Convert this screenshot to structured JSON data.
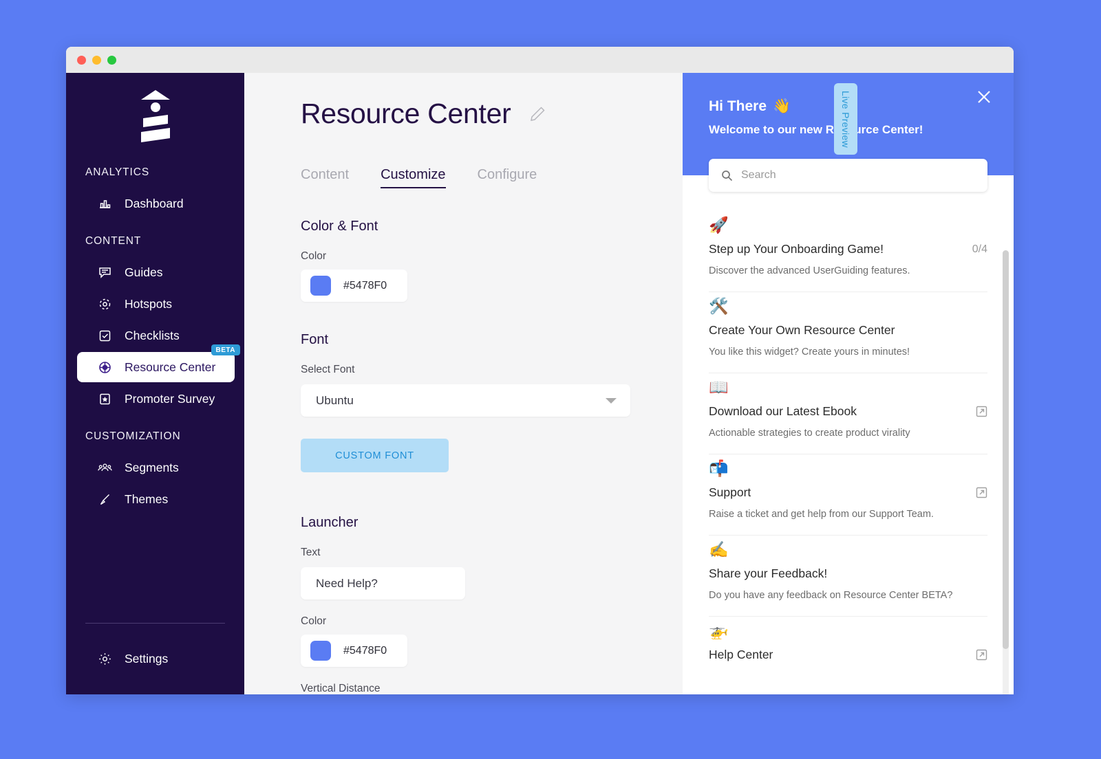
{
  "window": {
    "traffic_lights": [
      "close",
      "minimize",
      "maximize"
    ]
  },
  "sidebar": {
    "logo_name": "lighthouse-logo",
    "sections": [
      {
        "label": "ANALYTICS",
        "items": [
          {
            "label": "Dashboard",
            "icon": "bar-chart-icon",
            "active": false
          }
        ]
      },
      {
        "label": "CONTENT",
        "items": [
          {
            "label": "Guides",
            "icon": "speech-bubble-icon",
            "active": false
          },
          {
            "label": "Hotspots",
            "icon": "hotspot-icon",
            "active": false
          },
          {
            "label": "Checklists",
            "icon": "checkbox-icon",
            "active": false
          },
          {
            "label": "Resource Center",
            "icon": "lifebuoy-icon",
            "active": true,
            "badge": "BETA"
          },
          {
            "label": "Promoter Survey",
            "icon": "survey-icon",
            "active": false
          }
        ]
      },
      {
        "label": "CUSTOMIZATION",
        "items": [
          {
            "label": "Segments",
            "icon": "users-icon",
            "active": false
          },
          {
            "label": "Themes",
            "icon": "paintbrush-icon",
            "active": false
          }
        ]
      }
    ],
    "footer": {
      "label": "Settings",
      "icon": "gear-icon"
    }
  },
  "main": {
    "page_title": "Resource Center",
    "edit_icon": "pencil-icon",
    "tabs": [
      {
        "label": "Content",
        "active": false
      },
      {
        "label": "Customize",
        "active": true
      },
      {
        "label": "Configure",
        "active": false
      }
    ],
    "color_font": {
      "heading": "Color & Font",
      "color_label": "Color",
      "color_value": "#5478F0",
      "font_heading": "Font",
      "select_font_label": "Select Font",
      "selected_font": "Ubuntu",
      "custom_font_button": "CUSTOM FONT"
    },
    "launcher": {
      "heading": "Launcher",
      "text_label": "Text",
      "text_value": "Need Help?",
      "color_label": "Color",
      "color_value": "#5478F0",
      "vertical_distance_label": "Vertical Distance"
    }
  },
  "live_preview": {
    "label": "Live Preview"
  },
  "resource_center": {
    "greeting": "Hi There",
    "greeting_emoji": "👋",
    "subtitle": "Welcome to our new Resource Center!",
    "close_icon": "close-icon",
    "search": {
      "placeholder": "Search",
      "value": "",
      "icon": "search-icon"
    },
    "items": [
      {
        "emoji": "🚀",
        "icon_name": "rocket-emoji",
        "title": "Step up Your Onboarding Game!",
        "count": "0/4",
        "desc": "Discover the advanced UserGuiding features.",
        "external": false
      },
      {
        "emoji": "🛠️",
        "icon_name": "hammer-and-wrench-emoji",
        "title": "Create Your Own Resource Center",
        "count": "",
        "desc": "You like this widget? Create yours in minutes!",
        "external": false
      },
      {
        "emoji": "📖",
        "icon_name": "open-book-emoji",
        "title": "Download our Latest Ebook",
        "count": "",
        "desc": "Actionable strategies to create product virality",
        "external": true
      },
      {
        "emoji": "📬",
        "icon_name": "mailbox-emoji",
        "title": "Support",
        "count": "",
        "desc": "Raise a ticket and get help from our Support Team.",
        "external": true
      },
      {
        "emoji": "✍️",
        "icon_name": "writing-hand-emoji",
        "title": "Share your Feedback!",
        "count": "",
        "desc": "Do you have any feedback on Resource Center BETA?",
        "external": false
      },
      {
        "emoji": "🚁",
        "icon_name": "helicopter-emoji",
        "title": "Help Center",
        "count": "",
        "desc": "",
        "external": true
      }
    ]
  },
  "colors": {
    "brand_blue": "#5A7CF3",
    "sidebar_dark": "#1E0D44",
    "accent_light_blue": "#B3DDF7",
    "accent_blue_text": "#2E9BD6",
    "swatch": "#5A7CF3"
  }
}
